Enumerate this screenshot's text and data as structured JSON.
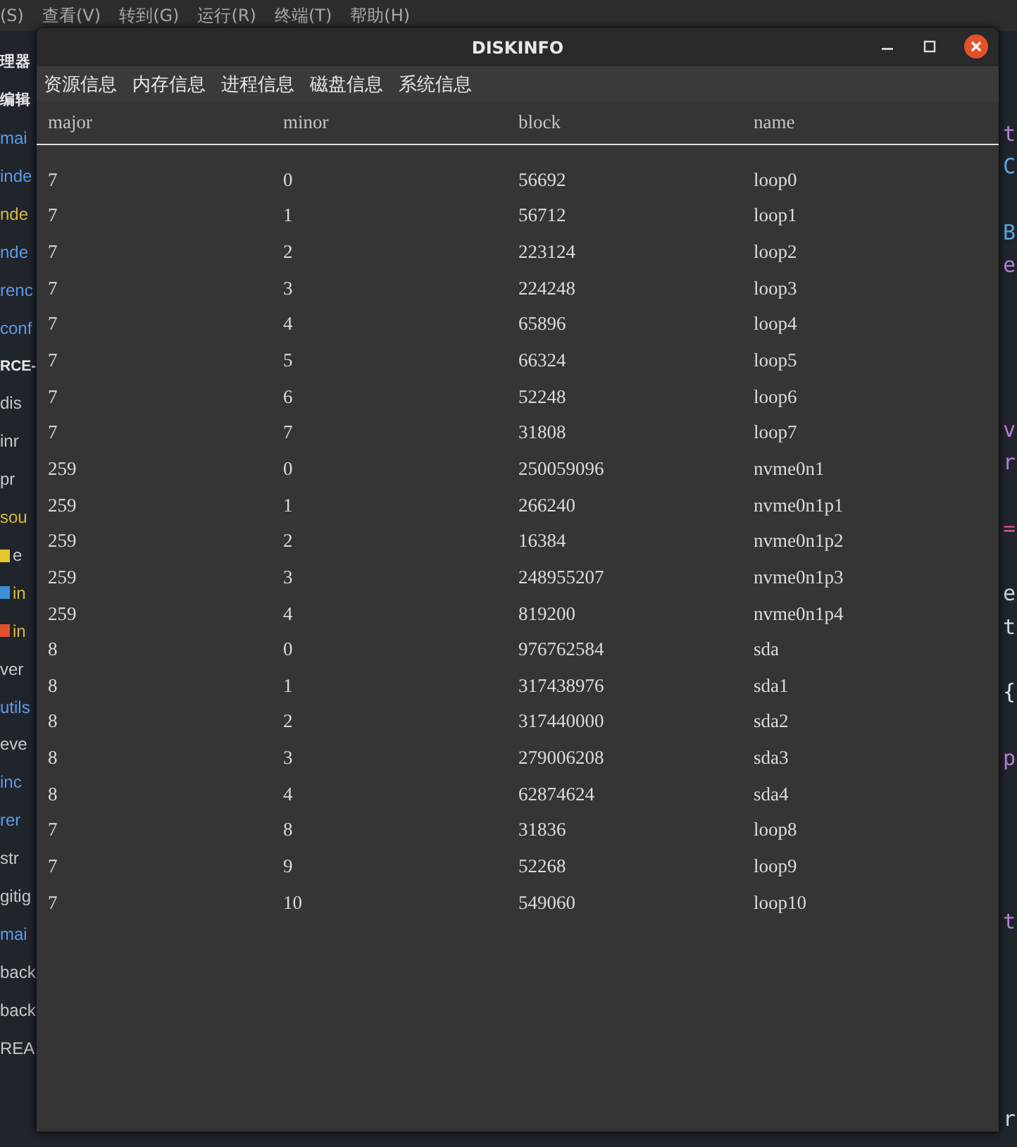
{
  "editor_menu": [
    "(S)",
    "查看(V)",
    "转到(G)",
    "运行(R)",
    "终端(T)",
    "帮助(H)"
  ],
  "explorer": [
    {
      "text": "理器",
      "color": "#e8e8e8",
      "kind": "heading"
    },
    {
      "text": "编辑",
      "color": "#e8e8e8",
      "kind": "heading"
    },
    {
      "text": "mai",
      "color": "#5b9bea",
      "kind": "file"
    },
    {
      "text": "inde",
      "color": "#5b9bea",
      "kind": "file"
    },
    {
      "text": "nde",
      "color": "#d7ba3d",
      "kind": "file"
    },
    {
      "text": "nde",
      "color": "#5b9bea",
      "kind": "file"
    },
    {
      "text": "renc",
      "color": "#5b9bea",
      "kind": "file"
    },
    {
      "text": "conf",
      "color": "#5b9bea",
      "kind": "file"
    },
    {
      "text": "RCE-",
      "color": "#e8e8e8",
      "kind": "heading"
    },
    {
      "text": "dis",
      "color": "#c8c8c8",
      "kind": "file"
    },
    {
      "text": "inr",
      "color": "#c8c8c8",
      "kind": "file"
    },
    {
      "text": "pr",
      "color": "#c8c8c8",
      "kind": "file"
    },
    {
      "text": "sou",
      "color": "#d7ba3d",
      "kind": "file"
    },
    {
      "text": "e",
      "color": "#c8c8c8",
      "kind": "js"
    },
    {
      "text": "in",
      "color": "#d7ba3d",
      "kind": "ts"
    },
    {
      "text": "in",
      "color": "#d7ba3d",
      "kind": "html"
    },
    {
      "text": "ver",
      "color": "#c8c8c8",
      "kind": "file"
    },
    {
      "text": "utils",
      "color": "#5b9bea",
      "kind": "file"
    },
    {
      "text": "eve",
      "color": "#c8c8c8",
      "kind": "file"
    },
    {
      "text": "inc",
      "color": "#5b9bea",
      "kind": "file"
    },
    {
      "text": "rer",
      "color": "#5b9bea",
      "kind": "file"
    },
    {
      "text": "str",
      "color": "#c8c8c8",
      "kind": "file"
    },
    {
      "text": "gitig",
      "color": "#c8c8c8",
      "kind": "file"
    },
    {
      "text": "mai",
      "color": "#5b9bea",
      "kind": "file"
    },
    {
      "text": "back",
      "color": "#c8c8c8",
      "kind": "file"
    },
    {
      "text": "back",
      "color": "#c8c8c8",
      "kind": "file"
    },
    {
      "text": "REA",
      "color": "#c8c8c8",
      "kind": "file"
    }
  ],
  "code_lines": [
    {
      "text": "t",
      "color": "#b57edc"
    },
    {
      "text": "C",
      "color": "#5aa9e6"
    },
    {
      "text": "B",
      "color": "#5aa9e6"
    },
    {
      "text": "e",
      "color": "#b57edc"
    },
    {
      "text": "v",
      "color": "#b57edc"
    },
    {
      "text": "r",
      "color": "#b57edc"
    },
    {
      "text": "=",
      "color": "#e0567a"
    },
    {
      "text": "e",
      "color": "#d4d4d4"
    },
    {
      "text": "t",
      "color": "#d4d4d4"
    },
    {
      "text": "{",
      "color": "#e0e0e0"
    },
    {
      "text": "p",
      "color": "#b57edc"
    },
    {
      "text": "t",
      "color": "#b57edc"
    },
    {
      "text": "r",
      "color": "#d4d4d4"
    }
  ],
  "window": {
    "title": "DISKINFO"
  },
  "menu": [
    {
      "label": "资源信息"
    },
    {
      "label": "内存信息"
    },
    {
      "label": "进程信息"
    },
    {
      "label": "磁盘信息"
    },
    {
      "label": "系统信息"
    }
  ],
  "table": {
    "columns": [
      "major",
      "minor",
      "block",
      "name"
    ],
    "rows": [
      [
        "7",
        "0",
        "56692",
        "loop0"
      ],
      [
        "7",
        "1",
        "56712",
        "loop1"
      ],
      [
        "7",
        "2",
        "223124",
        "loop2"
      ],
      [
        "7",
        "3",
        "224248",
        "loop3"
      ],
      [
        "7",
        "4",
        "65896",
        "loop4"
      ],
      [
        "7",
        "5",
        "66324",
        "loop5"
      ],
      [
        "7",
        "6",
        "52248",
        "loop6"
      ],
      [
        "7",
        "7",
        "31808",
        "loop7"
      ],
      [
        "259",
        "0",
        "250059096",
        "nvme0n1"
      ],
      [
        "259",
        "1",
        "266240",
        "nvme0n1p1"
      ],
      [
        "259",
        "2",
        "16384",
        "nvme0n1p2"
      ],
      [
        "259",
        "3",
        "248955207",
        "nvme0n1p3"
      ],
      [
        "259",
        "4",
        "819200",
        "nvme0n1p4"
      ],
      [
        "8",
        "0",
        "976762584",
        "sda"
      ],
      [
        "8",
        "1",
        "317438976",
        "sda1"
      ],
      [
        "8",
        "2",
        "317440000",
        "sda2"
      ],
      [
        "8",
        "3",
        "279006208",
        "sda3"
      ],
      [
        "8",
        "4",
        "62874624",
        "sda4"
      ],
      [
        "7",
        "8",
        "31836",
        "loop8"
      ],
      [
        "7",
        "9",
        "52268",
        "loop9"
      ],
      [
        "7",
        "10",
        "549060",
        "loop10"
      ]
    ]
  }
}
